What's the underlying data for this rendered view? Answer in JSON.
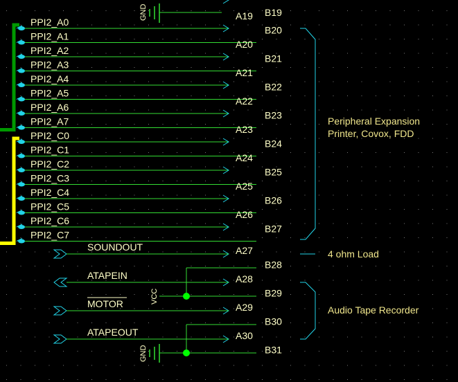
{
  "schematic": {
    "gnd_label": "GND",
    "vcc_label": "VCC",
    "bus_signals": [
      {
        "net": "PPI2_A0",
        "pin": "A19"
      },
      {
        "net": "PPI2_A1",
        "pin": "B20"
      },
      {
        "net": "PPI2_A2",
        "pin": "A20"
      },
      {
        "net": "PPI2_A3",
        "pin": "B21"
      },
      {
        "net": "PPI2_A4",
        "pin": "A21"
      },
      {
        "net": "PPI2_A5",
        "pin": "B22"
      },
      {
        "net": "PPI2_A6",
        "pin": "A22"
      },
      {
        "net": "PPI2_A7",
        "pin": "B23"
      },
      {
        "net": "PPI2_C0",
        "pin": "A23"
      },
      {
        "net": "PPI2_C1",
        "pin": "B24"
      },
      {
        "net": "PPI2_C2",
        "pin": "A24"
      },
      {
        "net": "PPI2_C3",
        "pin": "B25"
      },
      {
        "net": "PPI2_C4",
        "pin": "A25"
      },
      {
        "net": "PPI2_C5",
        "pin": "B26"
      },
      {
        "net": "PPI2_C6",
        "pin": "A26"
      },
      {
        "net": "PPI2_C7",
        "pin": "B27"
      }
    ],
    "top_pin": "B19",
    "lower_pins": [
      "A27",
      "B28",
      "A28",
      "B29",
      "A29",
      "B30",
      "A30",
      "B31"
    ],
    "ports": {
      "soundout": "SOUNDOUT",
      "atapein": "ATAPEIN",
      "motor": "MOTOR",
      "atapeout": "ATAPEOUT"
    },
    "notes": {
      "peripheral_line1": "Peripheral Expansion",
      "peripheral_line2": "Printer, Covox, FDD",
      "load": "4 ohm Load",
      "tape": "Audio Tape Recorder"
    },
    "colors": {
      "wire": "#33dd33",
      "connector": "#22d4e8",
      "bus_a": "#009900",
      "bus_c": "#ffff00",
      "junction": "#00ff00",
      "text": "#ffffc8",
      "note": "#f0e68c"
    }
  }
}
